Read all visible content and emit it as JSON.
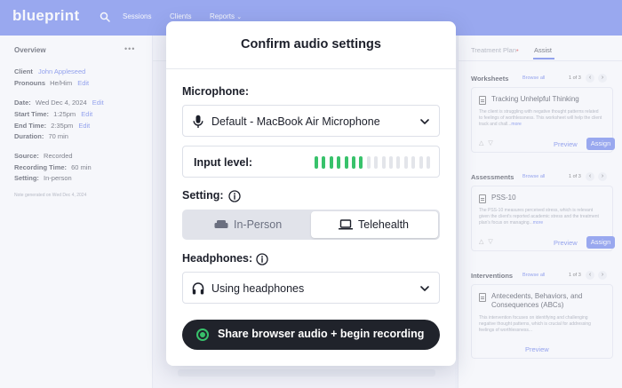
{
  "app": {
    "logo": "blueprint",
    "nav": [
      "Sessions",
      "Clients",
      "Reports"
    ]
  },
  "overview": {
    "title": "Overview",
    "menu_glyph": "•••",
    "client_label": "Client",
    "client_name": "John Appleseed",
    "pronouns_label": "Pronouns",
    "pronouns_value": "He/Him",
    "edit": "Edit",
    "date_label": "Date:",
    "date_value": "Wed Dec 4, 2024",
    "start_label": "Start Time:",
    "start_value": "1:25pm",
    "end_label": "End Time:",
    "end_value": "2:35pm",
    "duration_label": "Duration:",
    "duration_value": "70 min",
    "source_label": "Source:",
    "source_value": "Recorded",
    "recording_label": "Recording Time:",
    "recording_value": "60 min",
    "setting_label": "Setting:",
    "setting_value": "In-person",
    "note": "Note generated on Wed Dec 4, 2024"
  },
  "right_panel": {
    "tabs": [
      "Treatment Plan",
      "Assist"
    ],
    "active_tab": "Assist",
    "browse_all": "Browse all",
    "preview": "Preview",
    "assign": "Assign",
    "more": "more",
    "worksheets": {
      "title": "Worksheets",
      "pager": "1 of 3",
      "card_title": "Tracking Unhelpful Thinking",
      "card_desc": "The client is struggling with negative thought patterns related to feelings of worthlessness. This worksheet will help the client track and chall..."
    },
    "assessments": {
      "title": "Assessments",
      "pager": "1 of 3",
      "card_title": "PSS-10",
      "card_desc": "The PSS-10 measures perceived stress, which is relevant given the client's reported academic stress and the treatment plan's focus on managing..."
    },
    "interventions": {
      "title": "Interventions",
      "pager": "1 of 3",
      "card_title": "Antecedents, Behaviors, and Consequences (ABCs)",
      "card_desc": "This intervention focuses on identifying and challenging negative thought patterns, which is crucial for addressing feelings of worthlessness..."
    }
  },
  "modal": {
    "title": "Confirm audio settings",
    "microphone_label": "Microphone:",
    "microphone_value": "Default - MacBook Air Microphone",
    "input_level_label": "Input level:",
    "input_level": {
      "active_bars": 7,
      "total_bars": 16
    },
    "setting_label": "Setting:",
    "setting_options": [
      "In-Person",
      "Telehealth"
    ],
    "setting_selected": "Telehealth",
    "headphones_label": "Headphones:",
    "headphones_value": "Using headphones",
    "primary_button": "Share browser audio + begin recording"
  },
  "colors": {
    "brand": "#5670ea",
    "meter_active": "#38c26b",
    "meter_inactive": "#e3e5ea",
    "primary_button": "#20232b"
  },
  "icons": {
    "microphone": "microphone-icon",
    "info": "info-icon",
    "headphones": "headphones-icon",
    "couch": "couch-icon",
    "laptop": "laptop-icon",
    "chevron": "chevron-down-icon",
    "record": "record-icon",
    "search": "search-icon"
  }
}
